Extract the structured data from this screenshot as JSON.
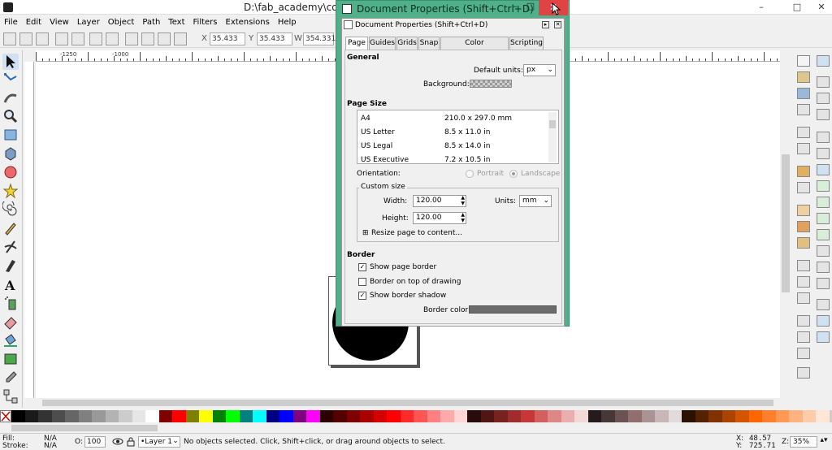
{
  "window": {
    "title": "D:\\fab_academy\\comp...cape",
    "controls": {
      "minimize": "–",
      "maximize": "□",
      "close": "✕"
    }
  },
  "menu": [
    "File",
    "Edit",
    "View",
    "Layer",
    "Object",
    "Path",
    "Text",
    "Filters",
    "Extensions",
    "Help"
  ],
  "toolbar": {
    "x_label": "X",
    "x_value": "35.433",
    "y_label": "Y",
    "y_value": "35.433",
    "w_label": "W",
    "w_value": "354.331"
  },
  "ruler": {
    "h_ticks": [
      "-1250",
      "-1000"
    ]
  },
  "dialog": {
    "window_title": "Document Properties (Shift+Ctrl+D)",
    "panel_title": "Document Properties (Shift+Ctrl+D)",
    "tabs": [
      "Page",
      "Guides",
      "Grids",
      "Snap",
      "Color Management",
      "Scripting"
    ],
    "general": {
      "heading": "General",
      "default_units_label": "Default units:",
      "default_units_value": "px",
      "background_label": "Background:"
    },
    "page_size": {
      "heading": "Page Size",
      "list": [
        {
          "name": "A4",
          "size": "210.0 x 297.0 mm"
        },
        {
          "name": "US Letter",
          "size": "8.5 x 11.0 in"
        },
        {
          "name": "US Legal",
          "size": "8.5 x 14.0 in"
        },
        {
          "name": "US Executive",
          "size": "7.2 x 10.5 in"
        }
      ],
      "orientation_label": "Orientation:",
      "portrait": "Portrait",
      "landscape": "Landscape",
      "custom_size_label": "Custom size",
      "width_label": "Width:",
      "width_value": "120.00",
      "height_label": "Height:",
      "height_value": "120.00",
      "units_label": "Units:",
      "units_value": "mm",
      "resize_label": "Resize page to content..."
    },
    "border": {
      "heading": "Border",
      "show_page_border": "Show page border",
      "border_on_top": "Border on top of drawing",
      "show_border_shadow": "Show border shadow",
      "border_color_label": "Border color:"
    }
  },
  "status": {
    "fill_label": "Fill:",
    "fill_value": "N/A",
    "stroke_label": "Stroke:",
    "stroke_value": "N/A",
    "opacity_label": "O:",
    "opacity_value": "100",
    "layer_value": "•Layer 1",
    "message": "No objects selected. Click, Shift+click, or drag around objects to select.",
    "x_label": "X:",
    "x_value": "48.57",
    "y_label": "Y:",
    "y_value": "725.71",
    "zoom_label": "Z:",
    "zoom_value": "35%"
  },
  "colors": {
    "dialog_frame": "#4fb08a",
    "close_button": "#e04343",
    "border_color": "#6b6b6b"
  },
  "palette": [
    "#000000",
    "#1a1a1a",
    "#333333",
    "#4d4d4d",
    "#666666",
    "#808080",
    "#999999",
    "#b3b3b3",
    "#cccccc",
    "#e6e6e6",
    "#ffffff",
    "#800000",
    "#ff0000",
    "#808000",
    "#ffff00",
    "#008000",
    "#00ff00",
    "#008080",
    "#00ffff",
    "#000080",
    "#0000ff",
    "#800080",
    "#ff00ff",
    "#2b0000",
    "#550000",
    "#800000",
    "#aa0000",
    "#d40000",
    "#ff0000",
    "#ff2a2a",
    "#ff5555",
    "#ff8080",
    "#ffaaaa",
    "#ffd5d5",
    "#280b0b",
    "#501616",
    "#782121",
    "#a02c2c",
    "#c83737",
    "#d35f5f",
    "#de8787",
    "#e9afaf",
    "#f4d7d7",
    "#241c1c",
    "#483737",
    "#6c5353",
    "#916f6f",
    "#ac9393",
    "#c8b7b7",
    "#e3dbdb",
    "#2b1100",
    "#552200",
    "#803300",
    "#aa4400",
    "#d45500",
    "#ff6600",
    "#ff7f2a",
    "#ff9955",
    "#ffb380",
    "#ffccaa",
    "#ffe6d5"
  ]
}
